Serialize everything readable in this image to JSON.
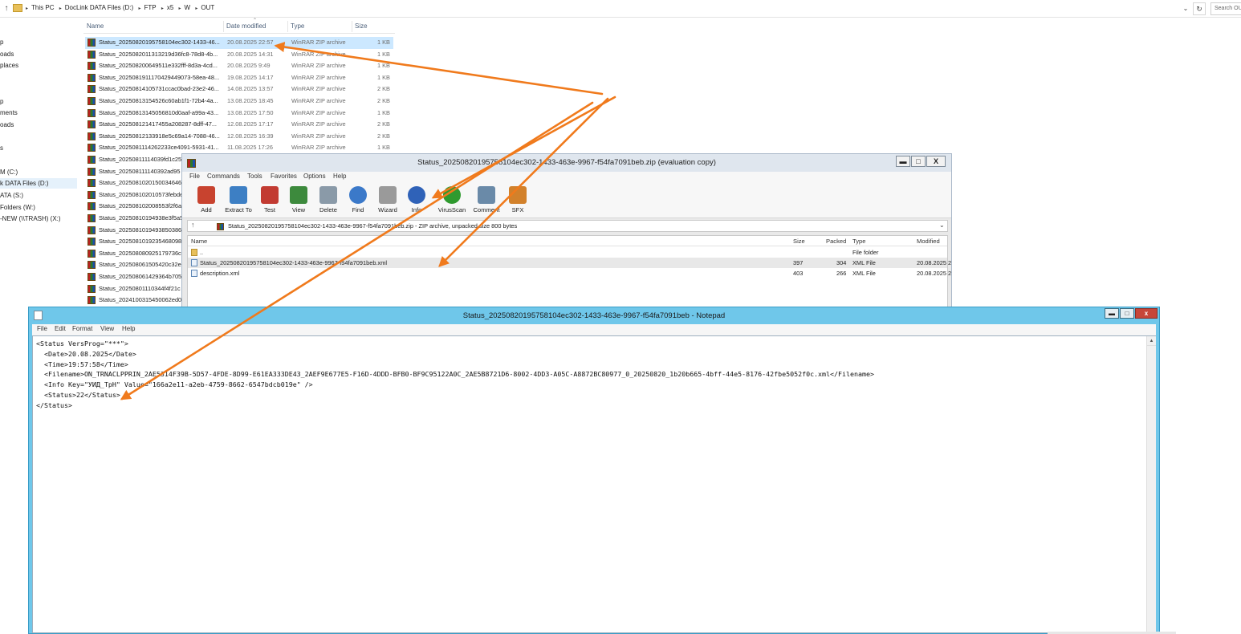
{
  "explorer": {
    "up_glyph": "↑",
    "breadcrumbs": [
      "This PC",
      "DocLink DATA Files (D:)",
      "FTP",
      "x5",
      "W",
      "OUT"
    ],
    "breadcrumb_sep": "▸",
    "dropdown_glyph": "⌄",
    "refresh_glyph": "↻",
    "search_placeholder": "Search OUT",
    "nav_items": [
      {
        "label": "p",
        "selected": false
      },
      {
        "label": "oads",
        "selected": false
      },
      {
        "label": "places",
        "selected": false
      },
      {
        "label": "p",
        "selected": false
      },
      {
        "label": "ments",
        "selected": false
      },
      {
        "label": "oads",
        "selected": false
      },
      {
        "label": "s",
        "selected": false
      },
      {
        "label": "M (C:)",
        "selected": false
      },
      {
        "label": "k DATA Files (D:)",
        "selected": true
      },
      {
        "label": "ATA (S:)",
        "selected": false
      },
      {
        "label": "Folders (W:)",
        "selected": false
      },
      {
        "label": "-NEW (\\\\TRASH) (X:)",
        "selected": false
      }
    ],
    "columns": {
      "name": "Name",
      "date": "Date modified",
      "type": "Type",
      "size": "Size"
    },
    "sort_caret": "⌃",
    "files": [
      {
        "name": "Status_20250820195758104ec302-1433-46...",
        "date": "20.08.2025 22:57",
        "type": "WinRAR ZIP archive",
        "size": "1 KB"
      },
      {
        "name": "Status_20250820113132​19d36fc8-78d8-4b...",
        "date": "20.08.2025 14:31",
        "type": "WinRAR ZIP archive",
        "size": "1 KB"
      },
      {
        "name": "Status_20250820064951​1e332fff-8d3a-4cd...",
        "date": "20.08.2025 9:49",
        "type": "WinRAR ZIP archive",
        "size": "1 KB"
      },
      {
        "name": "Status_20250819111704294490​73-58ea-48...",
        "date": "19.08.2025 14:17",
        "type": "WinRAR ZIP archive",
        "size": "1 KB"
      },
      {
        "name": "Status_20250814105731ccac0bad-23e2-46...",
        "date": "14.08.2025 13:57",
        "type": "WinRAR ZIP archive",
        "size": "2 KB"
      },
      {
        "name": "Status_20250813154526c60ab1f1-72b4-4a...",
        "date": "13.08.2025 18:45",
        "type": "WinRAR ZIP archive",
        "size": "2 KB"
      },
      {
        "name": "Status_20250813145056810d0aaf-a99a-43...",
        "date": "13.08.2025 17:50",
        "type": "WinRAR ZIP archive",
        "size": "1 KB"
      },
      {
        "name": "Status_20250812141745​5a208287-8dff-47...",
        "date": "12.08.2025 17:17",
        "type": "WinRAR ZIP archive",
        "size": "2 KB"
      },
      {
        "name": "Status_20250812133918e5c69a14-7088-46...",
        "date": "12.08.2025 16:39",
        "type": "WinRAR ZIP archive",
        "size": "2 KB"
      },
      {
        "name": "Status_20250811142622​33ce4091-5931-41...",
        "date": "11.08.2025 17:26",
        "type": "WinRAR ZIP archive",
        "size": "1 KB"
      },
      {
        "name": "Status_20250811114039fd1c25",
        "date": "",
        "type": "",
        "size": ""
      },
      {
        "name": "Status_20250811114039​2ad95",
        "date": "",
        "type": "",
        "size": ""
      },
      {
        "name": "Status_20250810201500346462",
        "date": "",
        "type": "",
        "size": ""
      },
      {
        "name": "Status_20250810201057​3febde",
        "date": "",
        "type": "",
        "size": ""
      },
      {
        "name": "Status_20250810200855​3f2f6a",
        "date": "",
        "type": "",
        "size": ""
      },
      {
        "name": "Status_20250810194938e3f5a5",
        "date": "",
        "type": "",
        "size": ""
      },
      {
        "name": "Status_20250810194938503860",
        "date": "",
        "type": "",
        "size": ""
      },
      {
        "name": "Status_20250810192354680980",
        "date": "",
        "type": "",
        "size": ""
      },
      {
        "name": "Status_20250808092517​9736cf",
        "date": "",
        "type": "",
        "size": ""
      },
      {
        "name": "Status_20250806150542​0c32ed",
        "date": "",
        "type": "",
        "size": ""
      },
      {
        "name": "Status_20250806142936​4b7051",
        "date": "",
        "type": "",
        "size": ""
      },
      {
        "name": "Status_20250801110344​f4f21c",
        "date": "",
        "type": "",
        "size": ""
      },
      {
        "name": "Status_20241003154500​62ed0",
        "date": "",
        "type": "",
        "size": ""
      }
    ]
  },
  "winrar": {
    "title": "Status_20250820195758104ec302-1433-463e-9967-f54fa7091beb.zip (evaluation copy)",
    "window_buttons": {
      "minimize": "▬",
      "maximize": "□",
      "close": "X"
    },
    "menu": [
      "File",
      "Commands",
      "Tools",
      "Favorites",
      "Options",
      "Help"
    ],
    "toolbar": [
      {
        "label": "Add",
        "icon": "add-archive-icon",
        "color": "#c8432f"
      },
      {
        "label": "Extract To",
        "icon": "extract-folder-icon",
        "color": "#3d7fc4"
      },
      {
        "label": "Test",
        "icon": "test-checklist-icon",
        "color": "#c23b32"
      },
      {
        "label": "View",
        "icon": "view-book-icon",
        "color": "#3d8a3d"
      },
      {
        "label": "Delete",
        "icon": "delete-trash-icon",
        "color": "#8a9aa8"
      },
      {
        "label": "Find",
        "icon": "find-magnifier-icon",
        "color": "#3b79c9"
      },
      {
        "label": "Wizard",
        "icon": "wizard-wand-icon",
        "color": "#9a9a9a"
      },
      {
        "label": "Info",
        "icon": "info-circle-icon",
        "color": "#2f62b8"
      },
      {
        "label": "VirusScan",
        "icon": "virus-scan-icon",
        "color": "#2f9a2f"
      },
      {
        "label": "Comment",
        "icon": "comment-icon",
        "color": "#6a8aa8"
      },
      {
        "label": "SFX",
        "icon": "sfx-box-icon",
        "color": "#d2812b"
      }
    ],
    "path_up_glyph": "↑",
    "path_text": "Status_20250820195758104ec302-1433-463e-9967-f54fa7091beb.zip - ZIP archive, unpacked size 800 bytes",
    "path_drop_glyph": "⌄",
    "columns": {
      "name": "Name",
      "size": "Size",
      "packed": "Packed",
      "type": "Type",
      "modified": "Modified"
    },
    "rows": [
      {
        "name": "..",
        "size": "",
        "packed": "",
        "type": "File folder",
        "modified": "",
        "kind": "folder"
      },
      {
        "name": "Status_20250820195758104ec302-1433-463e-9967-f54fa7091beb.xml",
        "size": "397",
        "packed": "304",
        "type": "XML File",
        "modified": "20.08.2025 2",
        "kind": "xml"
      },
      {
        "name": "description.xml",
        "size": "403",
        "packed": "266",
        "type": "XML File",
        "modified": "20.08.2025 2",
        "kind": "xml"
      }
    ]
  },
  "notepad": {
    "title": "Status_20250820195758104ec302-1433-463e-9967-f54fa7091beb - Notepad",
    "window_buttons": {
      "minimize": "▬",
      "maximize": "□",
      "close": "x"
    },
    "menu": [
      "File",
      "Edit",
      "Format",
      "View",
      "Help"
    ],
    "scroll_up_glyph": "▲",
    "lines": [
      "<Status VersProg=\"***\">",
      "  <Date>20.08.2025</Date>",
      "  <Time>19:57:58</Time>",
      "  <Filename>ON_TRNACLPPRIN_2AE5314F39B-5D57-4FDE-8D99-E61EA333DE43_2AEF9E677E5-F16D-4DDD-BFB0-BF9C95122A0C_2AE5B8721D6-8002-4DD3-A05C-A8872BC80977_0_20250820_1b20b665-4bff-44e5-8176-42fbe5052f0c.xml</Filename>",
      "  <Info Key=\"УИД_ТрН\" Value=\"166a2e11-a2eb-4759-8662-6547bdcb019e\" />",
      "  <Status>22</Status>",
      "</Status>"
    ]
  },
  "annotation_color": "#f07a1c"
}
